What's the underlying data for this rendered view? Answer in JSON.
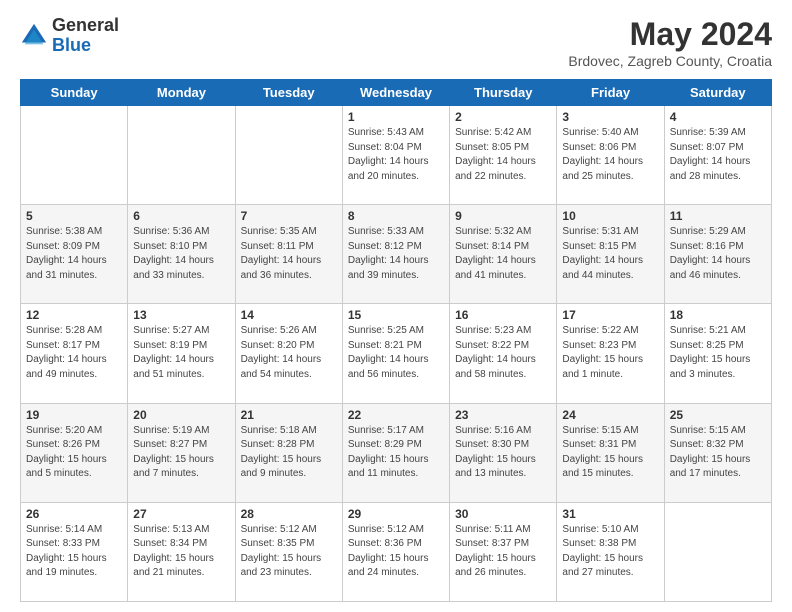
{
  "logo": {
    "general": "General",
    "blue": "Blue"
  },
  "title": "May 2024",
  "subtitle": "Brdovec, Zagreb County, Croatia",
  "days_of_week": [
    "Sunday",
    "Monday",
    "Tuesday",
    "Wednesday",
    "Thursday",
    "Friday",
    "Saturday"
  ],
  "weeks": [
    [
      {
        "day": "",
        "info": ""
      },
      {
        "day": "",
        "info": ""
      },
      {
        "day": "",
        "info": ""
      },
      {
        "day": "1",
        "info": "Sunrise: 5:43 AM\nSunset: 8:04 PM\nDaylight: 14 hours\nand 20 minutes."
      },
      {
        "day": "2",
        "info": "Sunrise: 5:42 AM\nSunset: 8:05 PM\nDaylight: 14 hours\nand 22 minutes."
      },
      {
        "day": "3",
        "info": "Sunrise: 5:40 AM\nSunset: 8:06 PM\nDaylight: 14 hours\nand 25 minutes."
      },
      {
        "day": "4",
        "info": "Sunrise: 5:39 AM\nSunset: 8:07 PM\nDaylight: 14 hours\nand 28 minutes."
      }
    ],
    [
      {
        "day": "5",
        "info": "Sunrise: 5:38 AM\nSunset: 8:09 PM\nDaylight: 14 hours\nand 31 minutes."
      },
      {
        "day": "6",
        "info": "Sunrise: 5:36 AM\nSunset: 8:10 PM\nDaylight: 14 hours\nand 33 minutes."
      },
      {
        "day": "7",
        "info": "Sunrise: 5:35 AM\nSunset: 8:11 PM\nDaylight: 14 hours\nand 36 minutes."
      },
      {
        "day": "8",
        "info": "Sunrise: 5:33 AM\nSunset: 8:12 PM\nDaylight: 14 hours\nand 39 minutes."
      },
      {
        "day": "9",
        "info": "Sunrise: 5:32 AM\nSunset: 8:14 PM\nDaylight: 14 hours\nand 41 minutes."
      },
      {
        "day": "10",
        "info": "Sunrise: 5:31 AM\nSunset: 8:15 PM\nDaylight: 14 hours\nand 44 minutes."
      },
      {
        "day": "11",
        "info": "Sunrise: 5:29 AM\nSunset: 8:16 PM\nDaylight: 14 hours\nand 46 minutes."
      }
    ],
    [
      {
        "day": "12",
        "info": "Sunrise: 5:28 AM\nSunset: 8:17 PM\nDaylight: 14 hours\nand 49 minutes."
      },
      {
        "day": "13",
        "info": "Sunrise: 5:27 AM\nSunset: 8:19 PM\nDaylight: 14 hours\nand 51 minutes."
      },
      {
        "day": "14",
        "info": "Sunrise: 5:26 AM\nSunset: 8:20 PM\nDaylight: 14 hours\nand 54 minutes."
      },
      {
        "day": "15",
        "info": "Sunrise: 5:25 AM\nSunset: 8:21 PM\nDaylight: 14 hours\nand 56 minutes."
      },
      {
        "day": "16",
        "info": "Sunrise: 5:23 AM\nSunset: 8:22 PM\nDaylight: 14 hours\nand 58 minutes."
      },
      {
        "day": "17",
        "info": "Sunrise: 5:22 AM\nSunset: 8:23 PM\nDaylight: 15 hours\nand 1 minute."
      },
      {
        "day": "18",
        "info": "Sunrise: 5:21 AM\nSunset: 8:25 PM\nDaylight: 15 hours\nand 3 minutes."
      }
    ],
    [
      {
        "day": "19",
        "info": "Sunrise: 5:20 AM\nSunset: 8:26 PM\nDaylight: 15 hours\nand 5 minutes."
      },
      {
        "day": "20",
        "info": "Sunrise: 5:19 AM\nSunset: 8:27 PM\nDaylight: 15 hours\nand 7 minutes."
      },
      {
        "day": "21",
        "info": "Sunrise: 5:18 AM\nSunset: 8:28 PM\nDaylight: 15 hours\nand 9 minutes."
      },
      {
        "day": "22",
        "info": "Sunrise: 5:17 AM\nSunset: 8:29 PM\nDaylight: 15 hours\nand 11 minutes."
      },
      {
        "day": "23",
        "info": "Sunrise: 5:16 AM\nSunset: 8:30 PM\nDaylight: 15 hours\nand 13 minutes."
      },
      {
        "day": "24",
        "info": "Sunrise: 5:15 AM\nSunset: 8:31 PM\nDaylight: 15 hours\nand 15 minutes."
      },
      {
        "day": "25",
        "info": "Sunrise: 5:15 AM\nSunset: 8:32 PM\nDaylight: 15 hours\nand 17 minutes."
      }
    ],
    [
      {
        "day": "26",
        "info": "Sunrise: 5:14 AM\nSunset: 8:33 PM\nDaylight: 15 hours\nand 19 minutes."
      },
      {
        "day": "27",
        "info": "Sunrise: 5:13 AM\nSunset: 8:34 PM\nDaylight: 15 hours\nand 21 minutes."
      },
      {
        "day": "28",
        "info": "Sunrise: 5:12 AM\nSunset: 8:35 PM\nDaylight: 15 hours\nand 23 minutes."
      },
      {
        "day": "29",
        "info": "Sunrise: 5:12 AM\nSunset: 8:36 PM\nDaylight: 15 hours\nand 24 minutes."
      },
      {
        "day": "30",
        "info": "Sunrise: 5:11 AM\nSunset: 8:37 PM\nDaylight: 15 hours\nand 26 minutes."
      },
      {
        "day": "31",
        "info": "Sunrise: 5:10 AM\nSunset: 8:38 PM\nDaylight: 15 hours\nand 27 minutes."
      },
      {
        "day": "",
        "info": ""
      }
    ]
  ]
}
